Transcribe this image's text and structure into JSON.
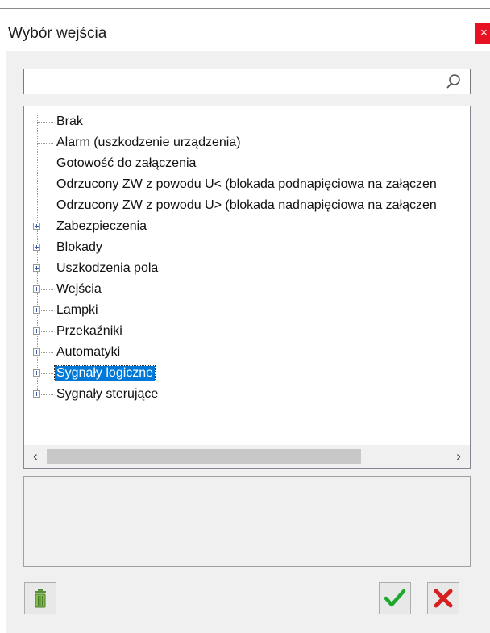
{
  "window": {
    "title": "Wybór wejścia",
    "close_glyph": "×"
  },
  "search": {
    "value": "",
    "icon": "search-icon"
  },
  "tree": {
    "items": [
      {
        "label": "Brak",
        "expandable": false,
        "selected": false
      },
      {
        "label": "Alarm (uszkodzenie urządzenia)",
        "expandable": false,
        "selected": false
      },
      {
        "label": "Gotowość do załączenia",
        "expandable": false,
        "selected": false
      },
      {
        "label": "Odrzucony ZW z powodu U< (blokada podnapięciowa na załączen",
        "expandable": false,
        "selected": false
      },
      {
        "label": "Odrzucony ZW z powodu U> (blokada nadnapięciowa na załączen",
        "expandable": false,
        "selected": false
      },
      {
        "label": "Zabezpieczenia",
        "expandable": true,
        "selected": false
      },
      {
        "label": "Blokady",
        "expandable": true,
        "selected": false
      },
      {
        "label": "Uszkodzenia pola",
        "expandable": true,
        "selected": false
      },
      {
        "label": "Wejścia",
        "expandable": true,
        "selected": false
      },
      {
        "label": "Lampki",
        "expandable": true,
        "selected": false
      },
      {
        "label": "Przekaźniki",
        "expandable": true,
        "selected": false
      },
      {
        "label": "Automatyki",
        "expandable": true,
        "selected": false
      },
      {
        "label": "Sygnały logiczne",
        "expandable": true,
        "selected": true
      },
      {
        "label": "Sygnały sterujące",
        "expandable": true,
        "selected": false
      }
    ],
    "scroll": {
      "left_glyph": "‹",
      "right_glyph": "›"
    }
  },
  "description": {
    "text": ""
  },
  "buttons": {
    "delete": {
      "icon": "trash-icon"
    },
    "ok": {
      "icon": "checkmark-icon",
      "color": "#1fa82d"
    },
    "cancel": {
      "icon": "x-icon",
      "color": "#d62020"
    }
  },
  "colors": {
    "selection": "#0078d7",
    "close": "#e81123",
    "dialog_bg": "#f0f0f0"
  }
}
